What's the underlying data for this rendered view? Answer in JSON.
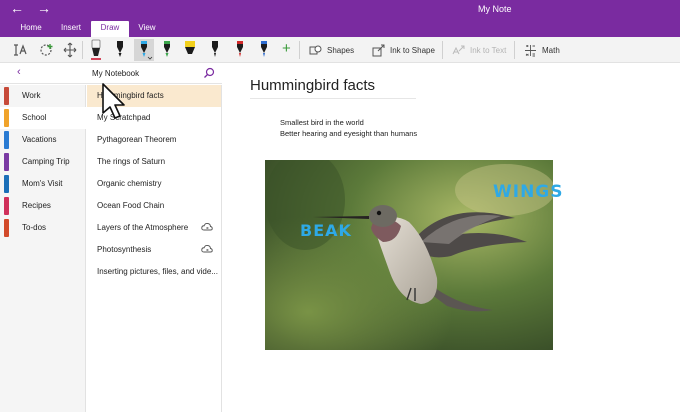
{
  "window": {
    "title": "My Note",
    "back_glyph": "←",
    "forward_glyph": "→"
  },
  "tabs": [
    {
      "label": "Home",
      "active": false
    },
    {
      "label": "Insert",
      "active": false
    },
    {
      "label": "Draw",
      "active": true
    },
    {
      "label": "View",
      "active": false
    }
  ],
  "ribbon": {
    "tools": [
      "lasso-select-icon",
      "add-space-icon",
      "eraser-icon"
    ],
    "pens": [
      {
        "name": "pen-white-icon",
        "color": "#f4f4f4"
      },
      {
        "name": "pen-black-icon",
        "color": "#1c1c1c"
      },
      {
        "name": "pen-blue-icon",
        "color": "#2ea9e6",
        "selected": true
      },
      {
        "name": "pen-green-icon",
        "color": "#3aa54a"
      },
      {
        "name": "highlighter-yellow-icon",
        "color": "#f2d01c"
      },
      {
        "name": "pen-black-2-icon",
        "color": "#1c1c1c"
      },
      {
        "name": "pen-red-icon",
        "color": "#d22a2a"
      },
      {
        "name": "pen-blue-2-icon",
        "color": "#2d6ccf"
      }
    ],
    "add_glyph": "+",
    "shapes_label": "Shapes",
    "ink_to_shape_label": "Ink to Shape",
    "ink_to_text_label": "Ink to Text",
    "math_label": "Math"
  },
  "notebook": {
    "name": "My Notebook",
    "back_glyph": "‹"
  },
  "sections": [
    {
      "label": "Work",
      "color": "#c74a39"
    },
    {
      "label": "School",
      "color": "#f0a32b",
      "active": true
    },
    {
      "label": "Vacations",
      "color": "#2a7bd2"
    },
    {
      "label": "Camping Trip",
      "color": "#7a3aa3"
    },
    {
      "label": "Mom's Visit",
      "color": "#1b6fb8"
    },
    {
      "label": "Recipes",
      "color": "#d0305a"
    },
    {
      "label": "To-dos",
      "color": "#d24a2a"
    }
  ],
  "pages": [
    {
      "label": "Hummingbird facts",
      "active": true,
      "sync": false
    },
    {
      "label": "My Scratchpad",
      "sync": false
    },
    {
      "label": "Pythagorean Theorem",
      "sync": false
    },
    {
      "label": "The rings of Saturn",
      "sync": false
    },
    {
      "label": "Organic chemistry",
      "sync": false
    },
    {
      "label": "Ocean Food Chain",
      "sync": false
    },
    {
      "label": "Layers of the Atmosphere",
      "sync": true
    },
    {
      "label": "Photosynthesis",
      "sync": true
    },
    {
      "label": "Inserting pictures, files, and vide...",
      "sync": false
    }
  ],
  "note": {
    "title": "Hummingbird facts",
    "lines": [
      "Smallest bird in the world",
      "Better hearing and eyesight than humans"
    ],
    "ink_labels": {
      "wings": "WINGS",
      "beak": "BEAK"
    }
  }
}
